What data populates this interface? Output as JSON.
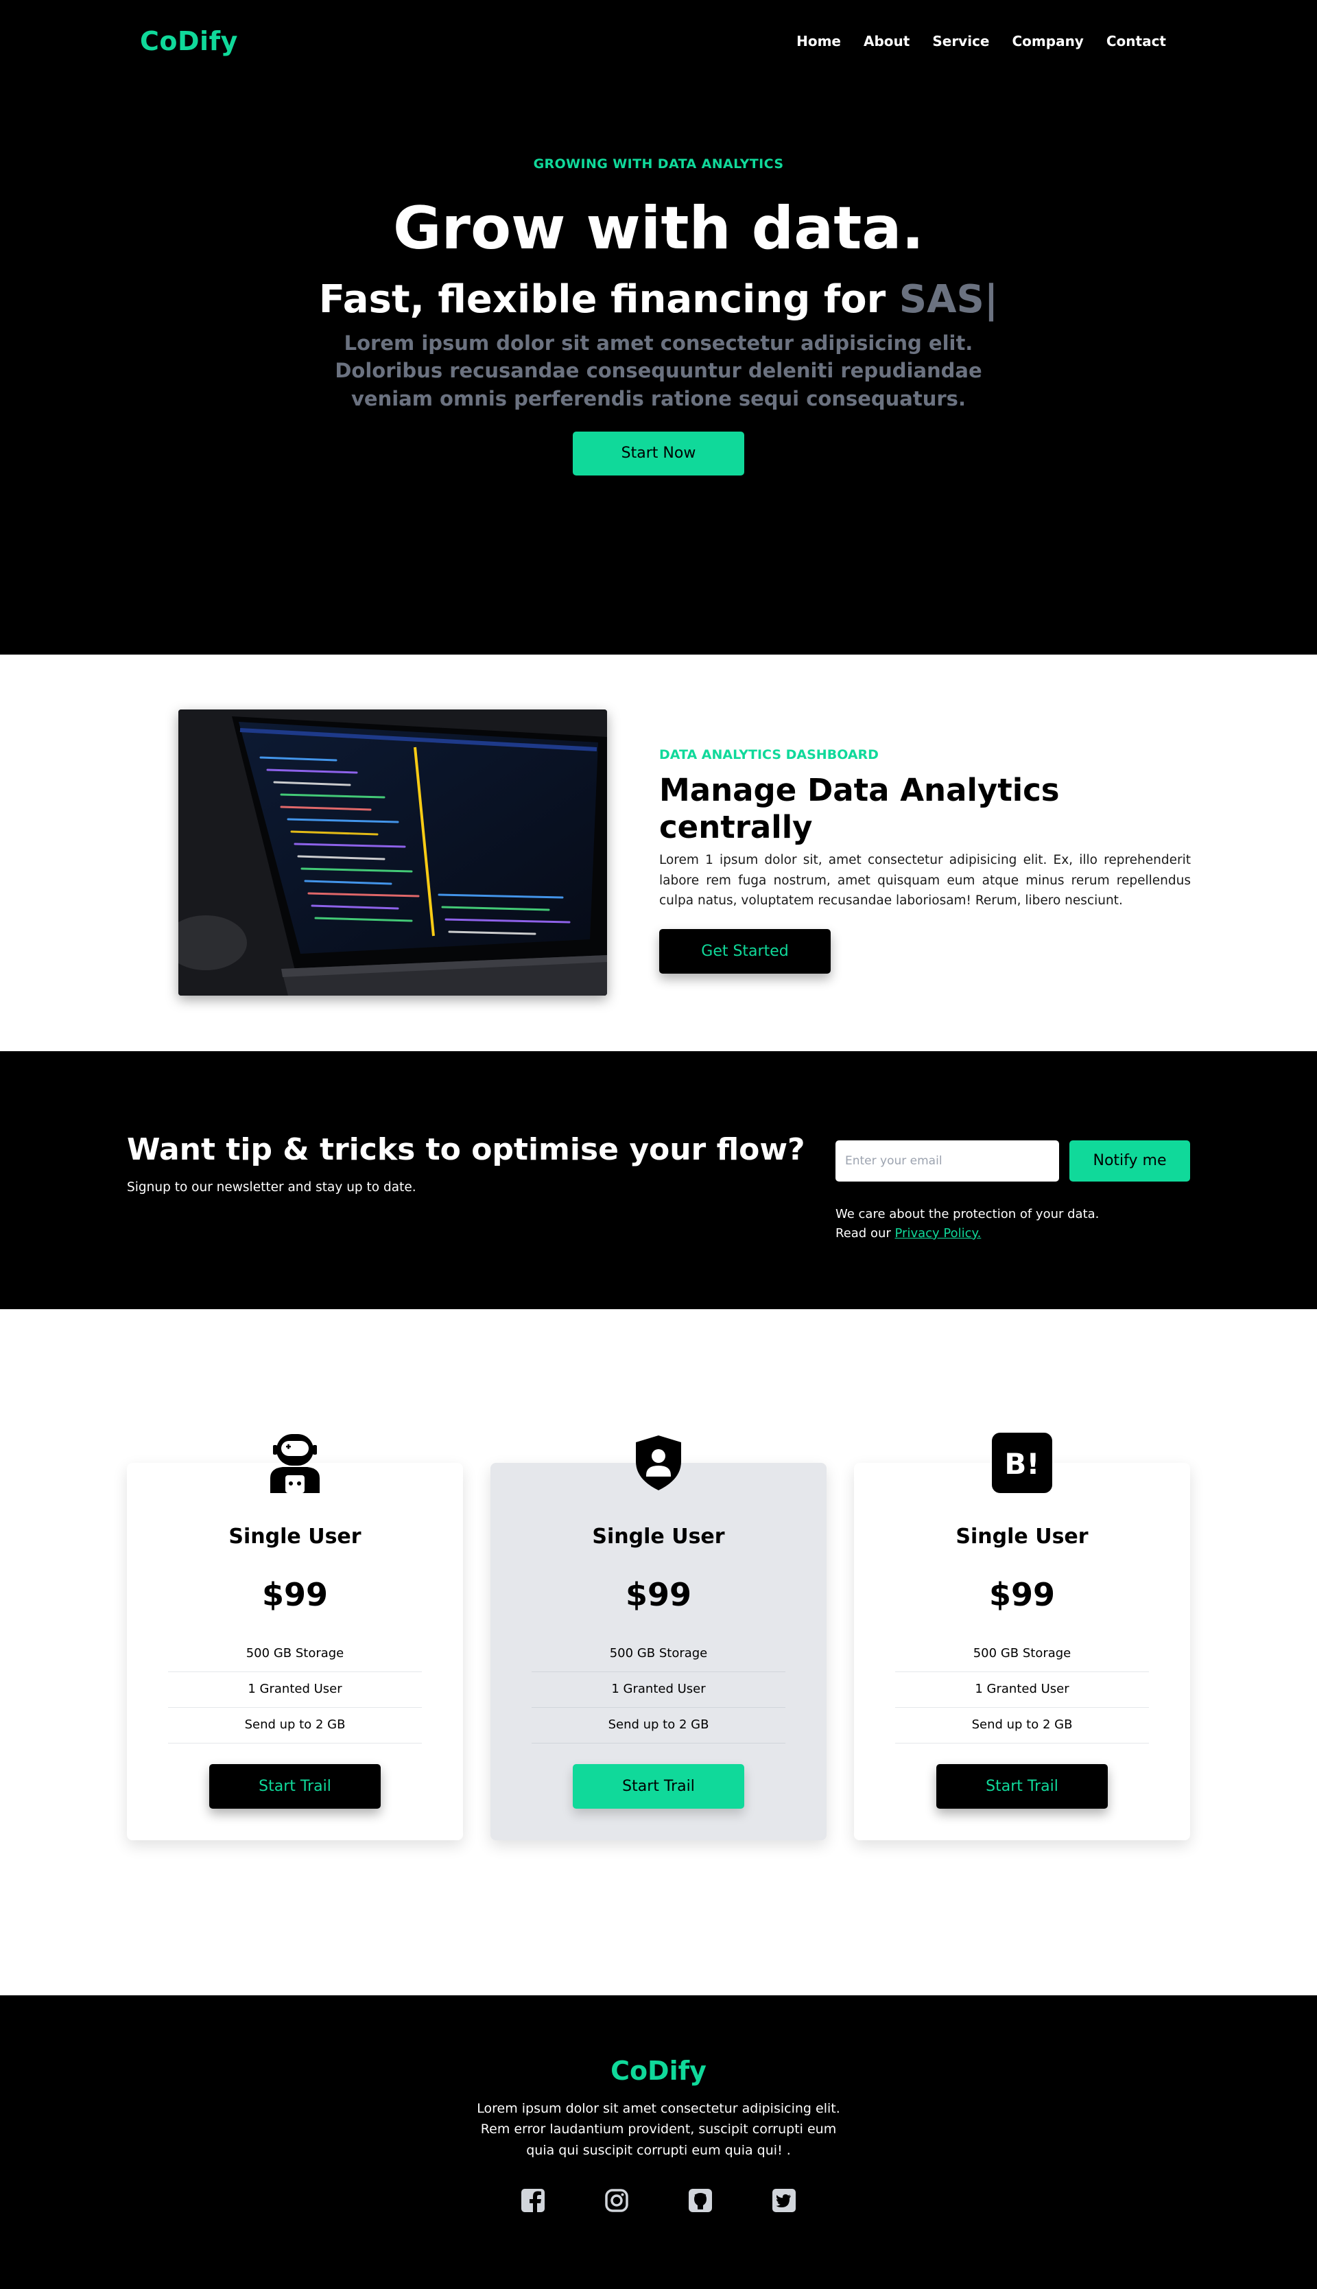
{
  "brand": {
    "name": "CoDify",
    "accent": "#10d99a"
  },
  "nav": {
    "items": [
      {
        "label": "Home"
      },
      {
        "label": "About"
      },
      {
        "label": "Service"
      },
      {
        "label": "Company"
      },
      {
        "label": "Contact"
      }
    ]
  },
  "hero": {
    "eyebrow": "GROWING WITH DATA ANALYTICS",
    "title": "Grow with data.",
    "subtitle_prefix": "Fast, flexible financing for ",
    "subtitle_accent": "SAS|",
    "description": "Lorem ipsum dolor sit amet consectetur adipisicing elit. Doloribus recusandae consequuntur deleniti repudiandae veniam omnis perferendis ratione sequi consequaturs.",
    "cta": "Start Now"
  },
  "about": {
    "eyebrow": "DATA ANALYTICS DASHBOARD",
    "title": "Manage Data Analytics centrally",
    "description": "Lorem 1 ipsum dolor sit, amet consectetur adipisicing elit. Ex, illo reprehenderit labore rem fuga nostrum, amet quisquam eum atque minus rerum repellendus culpa natus, voluptatem recusandae laboriosam! Rerum, libero nesciunt.",
    "cta": "Get Started"
  },
  "newsletter": {
    "title": "Want tip & tricks to optimise your flow?",
    "subtitle": "Signup to our newsletter and stay up to date.",
    "placeholder": "Enter your email",
    "button": "Notify me",
    "note_line1": "We care about the protection of your data.",
    "note_prefix": "Read our ",
    "note_link": "Privacy Policy."
  },
  "pricing": {
    "plans": [
      {
        "icon": "astronaut-icon",
        "title": "Single User",
        "price": "$99",
        "features": [
          "500 GB Storage",
          "1 Granted User",
          "Send up to 2 GB"
        ],
        "cta": "Start Trail"
      },
      {
        "icon": "user-shield-icon",
        "title": "Single User",
        "price": "$99",
        "features": [
          "500 GB Storage",
          "1 Granted User",
          "Send up to 2 GB"
        ],
        "cta": "Start Trail"
      },
      {
        "icon": "hatena-bookmark-icon",
        "title": "Single User",
        "price": "$99",
        "features": [
          "500 GB Storage",
          "1 Granted User",
          "Send up to 2 GB"
        ],
        "cta": "Start Trail"
      }
    ]
  },
  "footer": {
    "logo": "CoDify",
    "description": "Lorem ipsum dolor sit amet consectetur adipisicing elit. Rem error laudantium provident, suscipit corrupti eum quia qui suscipit corrupti eum quia qui! .",
    "socials": [
      "facebook-icon",
      "instagram-icon",
      "github-icon",
      "twitter-icon"
    ]
  }
}
